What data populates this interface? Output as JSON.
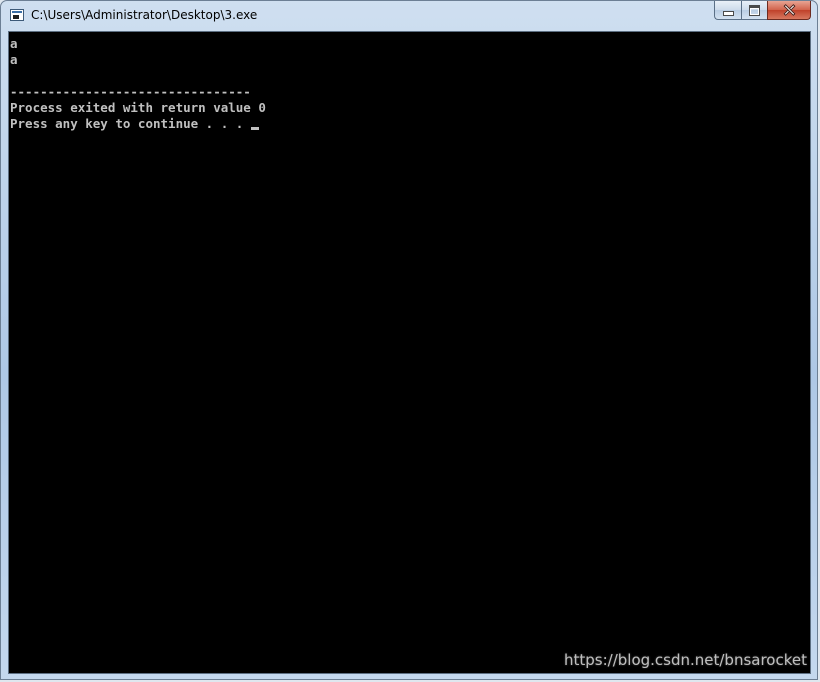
{
  "window": {
    "title": "C:\\Users\\Administrator\\Desktop\\3.exe",
    "icon": "console-app-icon",
    "buttons": {
      "minimize": "minimize-icon",
      "maximize": "maximize-icon",
      "close": "close-icon",
      "close_color": "#c8452e"
    }
  },
  "console": {
    "background": "#000000",
    "text_color": "#c0c0c0",
    "lines": [
      "a",
      "a",
      "",
      "--------------------------------",
      "Process exited with return value 0",
      "Press any key to continue . . . "
    ],
    "cursor_visible": true
  },
  "watermark": "https://blog.csdn.net/bnsarocket"
}
